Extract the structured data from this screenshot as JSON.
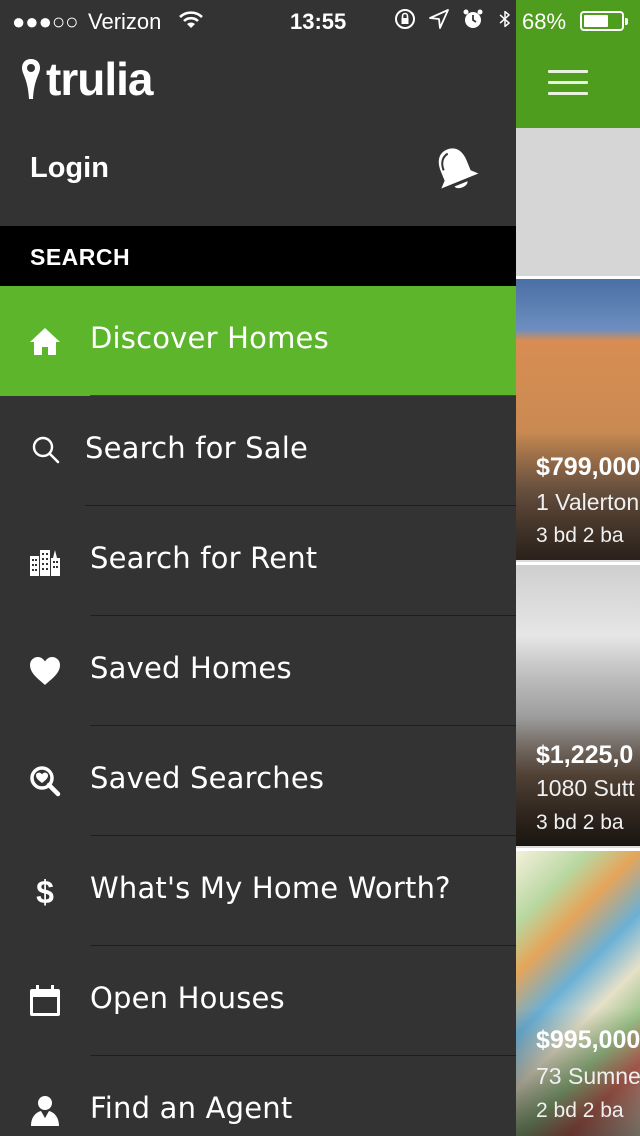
{
  "status_bar": {
    "signal": "●●●○○",
    "carrier": "Verizon",
    "time": "13:55",
    "battery_pct": "68%",
    "battery_level": 0.68
  },
  "brand": {
    "logo_text": "trulia"
  },
  "header": {
    "login_label": "Login"
  },
  "section": {
    "title": "SEARCH"
  },
  "menu": {
    "items": [
      {
        "label": "Discover Homes",
        "icon": "home-icon",
        "active": true
      },
      {
        "label": "Search for Sale",
        "icon": "search-icon",
        "active": false
      },
      {
        "label": "Search for Rent",
        "icon": "buildings-icon",
        "active": false
      },
      {
        "label": "Saved Homes",
        "icon": "heart-icon",
        "active": false
      },
      {
        "label": "Saved Searches",
        "icon": "heart-search-icon",
        "active": false
      },
      {
        "label": "What's My Home Worth?",
        "icon": "dollar-icon",
        "active": false
      },
      {
        "label": "Open Houses",
        "icon": "calendar-icon",
        "active": false
      },
      {
        "label": "Find an Agent",
        "icon": "agent-icon",
        "active": false
      }
    ]
  },
  "listings": [
    {
      "price": "$799,000",
      "address": "1 Valerton",
      "beds": "3 bd   2 ba"
    },
    {
      "price": "$1,225,0",
      "address": "1080 Sutt",
      "beds": "3 bd   2 ba"
    },
    {
      "price": "$995,000",
      "address": "73 Sumne",
      "beds": "2 bd   2 ba"
    }
  ],
  "colors": {
    "brand_green": "#5db52b",
    "topbar_green": "#4f9d1f",
    "drawer_bg": "#333333",
    "section_bg": "#000000"
  }
}
